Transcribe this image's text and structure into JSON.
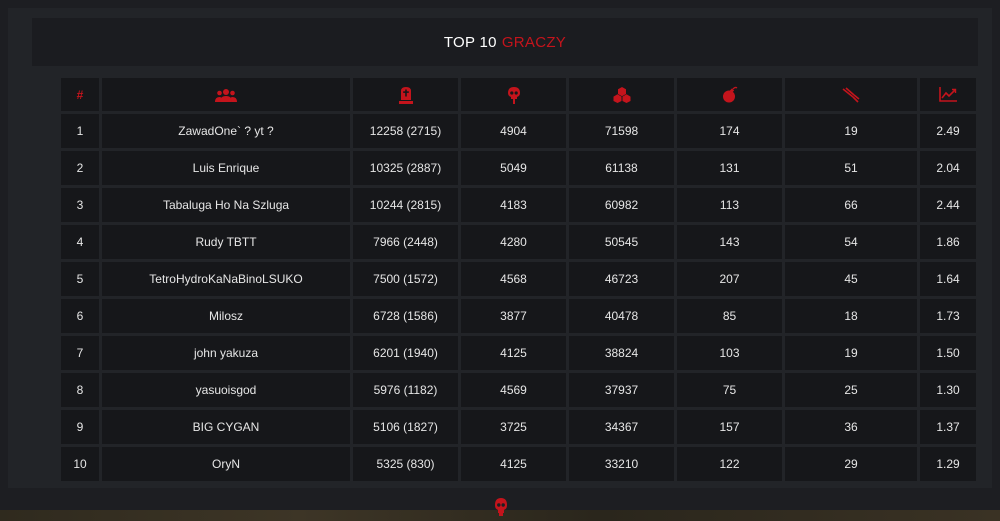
{
  "title": {
    "main": "TOP 10",
    "accent": "GRACZY"
  },
  "colors": {
    "accent": "#c4141c",
    "cell_bg": "#16171a",
    "panel_bg": "#222428"
  },
  "table": {
    "header": {
      "rank": "#",
      "icons": [
        "players-icon",
        "tombstone-points-icon",
        "skull-kills-icon",
        "blocks-damage-icon",
        "bomb-icon",
        "defuse-wire-cutter-icon",
        "trend-chart-icon"
      ]
    },
    "rows": [
      {
        "rank": "1",
        "name": "ZawadOne` ? yt ?",
        "points": "12258 (2715)",
        "kills": "4904",
        "damage": "71598",
        "bombs": "174",
        "defuses": "19",
        "kd": "2.49"
      },
      {
        "rank": "2",
        "name": "Luis Enrique",
        "points": "10325 (2887)",
        "kills": "5049",
        "damage": "61138",
        "bombs": "131",
        "defuses": "51",
        "kd": "2.04"
      },
      {
        "rank": "3",
        "name": "Tabaluga Ho Na Szluga",
        "points": "10244 (2815)",
        "kills": "4183",
        "damage": "60982",
        "bombs": "113",
        "defuses": "66",
        "kd": "2.44"
      },
      {
        "rank": "4",
        "name": "Rudy TBTT",
        "points": "7966 (2448)",
        "kills": "4280",
        "damage": "50545",
        "bombs": "143",
        "defuses": "54",
        "kd": "1.86"
      },
      {
        "rank": "5",
        "name": "TetroHydroKaNaBinoLSUKO",
        "points": "7500 (1572)",
        "kills": "4568",
        "damage": "46723",
        "bombs": "207",
        "defuses": "45",
        "kd": "1.64"
      },
      {
        "rank": "6",
        "name": "Milosz",
        "points": "6728 (1586)",
        "kills": "3877",
        "damage": "40478",
        "bombs": "85",
        "defuses": "18",
        "kd": "1.73"
      },
      {
        "rank": "7",
        "name": "john yakuza",
        "points": "6201 (1940)",
        "kills": "4125",
        "damage": "38824",
        "bombs": "103",
        "defuses": "19",
        "kd": "1.50"
      },
      {
        "rank": "8",
        "name": "yasuoisgod",
        "points": "5976 (1182)",
        "kills": "4569",
        "damage": "37937",
        "bombs": "75",
        "defuses": "25",
        "kd": "1.30"
      },
      {
        "rank": "9",
        "name": "BIG CYGAN",
        "points": "5106 (1827)",
        "kills": "3725",
        "damage": "34367",
        "bombs": "157",
        "defuses": "36",
        "kd": "1.37"
      },
      {
        "rank": "10",
        "name": "OryN",
        "points": "5325 (830)",
        "kills": "4125",
        "damage": "33210",
        "bombs": "122",
        "defuses": "29",
        "kd": "1.29"
      }
    ]
  },
  "footer": {
    "logo_icon": "skull-logo-icon"
  }
}
